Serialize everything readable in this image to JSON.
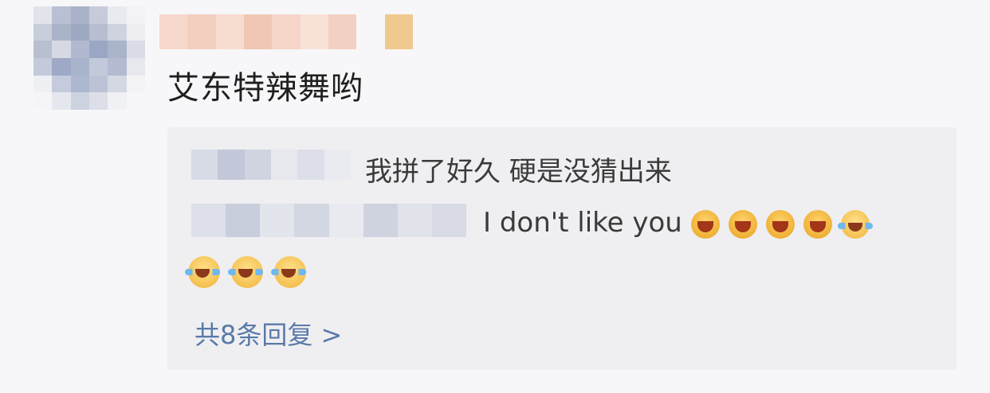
{
  "comment": {
    "text": "艾东特辣舞哟"
  },
  "replies": [
    {
      "text": "我拼了好久 硬是没猜出来"
    },
    {
      "text": "I don't like you",
      "emojis": [
        "laugh-emoji",
        "laugh-emoji",
        "laugh-emoji",
        "laugh-emoji",
        "tears-of-joy-emoji"
      ]
    }
  ],
  "reply_emojis_line2": [
    "tears-of-joy-emoji",
    "tears-of-joy-emoji",
    "tears-of-joy-emoji"
  ],
  "more_replies_label": "共8条回复 >",
  "colors": {
    "link": "#5a7aa8",
    "reply_box_bg": "#efeff2",
    "text_main": "#1f1f1f"
  }
}
